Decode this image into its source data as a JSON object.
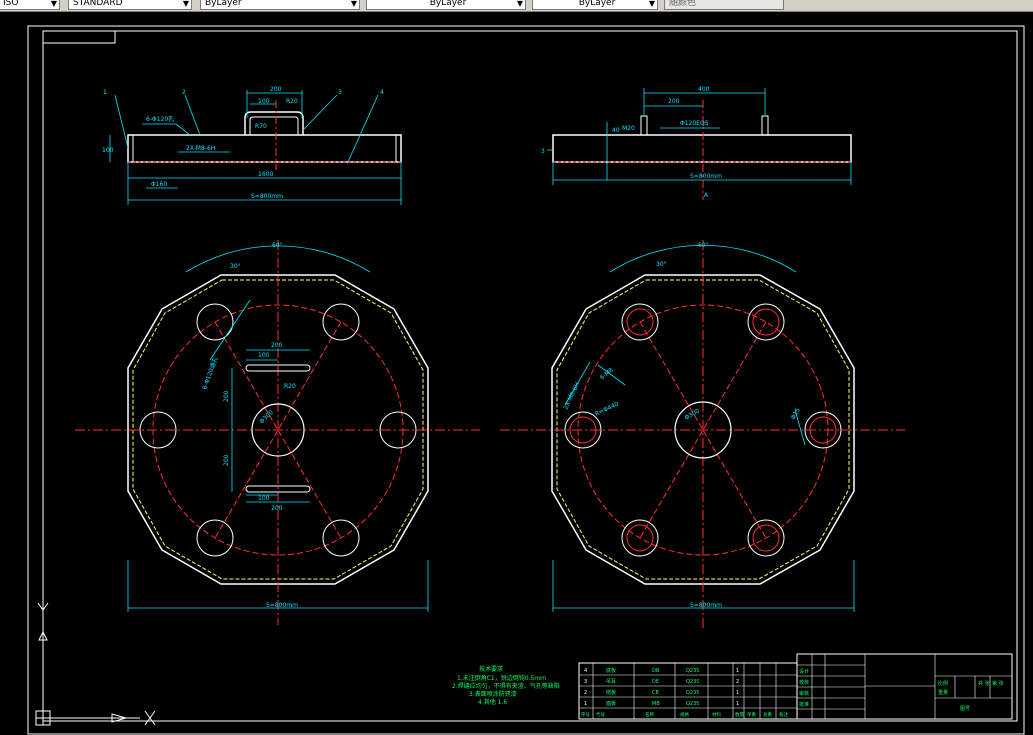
{
  "toolbar": {
    "items": [
      {
        "label": "ISO",
        "kind": "dropdown"
      },
      {
        "label": "STANDARD",
        "kind": "dropdown"
      },
      {
        "label": "ByLayer",
        "kind": "dropdown"
      },
      {
        "label": "ByLayer",
        "kind": "dropdown"
      },
      {
        "label": "ByLayer",
        "kind": "dropdown"
      },
      {
        "label": "随颜色",
        "kind": "dropdown"
      }
    ]
  },
  "colors": {
    "background": "#000000",
    "dim": "#00e5ff",
    "center": "#ff2020",
    "outline": "#ffffff",
    "hidden": "#ffff60",
    "text": "#00ff66"
  },
  "drawing": {
    "front_view_left": {
      "balloons": [
        "1",
        "2",
        "3",
        "4"
      ],
      "dims": [
        "6-Φ120孔",
        "200",
        "100",
        "R20",
        "R70",
        "100",
        "2X-M8-6H",
        "1600",
        "Φ160",
        "S=800mm"
      ]
    },
    "front_view_right": {
      "dims": [
        "400",
        "200",
        "Φ120EQS",
        "M20",
        "40",
        "3",
        "S=800mm",
        "A"
      ]
    },
    "plan_left": {
      "dims": [
        "60°",
        "30°",
        "6-Φ120通孔",
        "200",
        "100",
        "R20",
        "200",
        "200",
        "Φ300",
        "100",
        "200",
        "S=800mm"
      ]
    },
    "plan_right": {
      "dims": [
        "60°",
        "30°",
        "6-M8",
        "2X-M8-6H",
        "R=Φ440",
        "Φ300",
        "Φ15",
        "S=800mm"
      ]
    },
    "notes": {
      "title": "技术要求",
      "lines": [
        "1.未注倒角C1，锐边倒钝0.5mm",
        "2.焊缝应均匀，不得有夹渣、气孔等缺陷",
        "3.表面喷涂防锈漆",
        "4.其他 1.6"
      ]
    },
    "bom": {
      "rows": [
        {
          "no": "4",
          "name": "底板",
          "qty": "1",
          "material": "Q235",
          "code": "DB"
        },
        {
          "no": "3",
          "name": "吊耳",
          "qty": "2",
          "material": "Q235",
          "code": "DE"
        },
        {
          "no": "2",
          "name": "侧板",
          "qty": "1",
          "material": "Q235",
          "code": "CB"
        },
        {
          "no": "1",
          "name": "面板",
          "qty": "1",
          "material": "Q235",
          "code": "MB"
        }
      ],
      "header": [
        "序号",
        "代号",
        "名称",
        "规格",
        "材料",
        "数量",
        "单重",
        "总重",
        "备注"
      ],
      "title_block": [
        "设计",
        "校核",
        "审核",
        "批准",
        "比例",
        "重量",
        "共 张",
        "第 张",
        "图号"
      ]
    }
  }
}
